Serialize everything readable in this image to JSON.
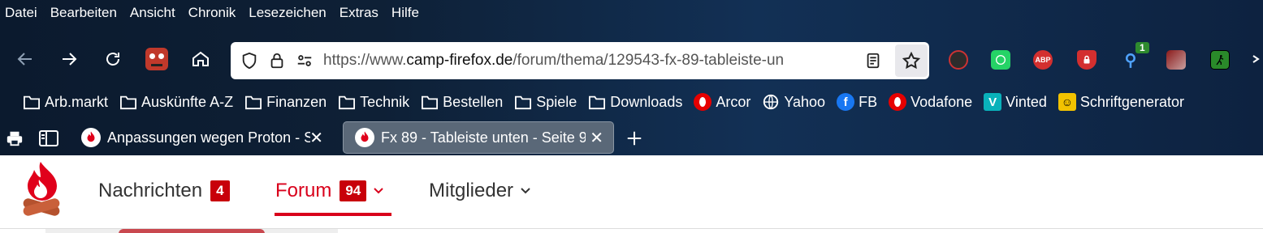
{
  "menubar": {
    "items": [
      "Datei",
      "Bearbeiten",
      "Ansicht",
      "Chronik",
      "Lesezeichen",
      "Extras",
      "Hilfe"
    ]
  },
  "toolbar": {
    "back_icon": "arrow-left-icon",
    "forward_icon": "arrow-right-icon",
    "reload_icon": "reload-icon",
    "home_icon": "home-icon"
  },
  "urlbar": {
    "url_prefix": "https://www.",
    "url_domain": "camp-firefox.de",
    "url_path": "/forum/thema/129543-fx-89-tableiste-un"
  },
  "extensions": {
    "badge_count": "1",
    "abp_label": "ABP"
  },
  "bookmarks": {
    "items": [
      {
        "label": "Arb.markt",
        "icon": "folder-icon"
      },
      {
        "label": "Auskünfte A-Z",
        "icon": "folder-icon"
      },
      {
        "label": "Finanzen",
        "icon": "folder-icon"
      },
      {
        "label": "Technik",
        "icon": "folder-icon"
      },
      {
        "label": "Bestellen",
        "icon": "folder-icon"
      },
      {
        "label": "Spiele",
        "icon": "folder-icon"
      },
      {
        "label": "Downloads",
        "icon": "folder-icon"
      },
      {
        "label": "Arcor",
        "icon": "vodafone-icon"
      },
      {
        "label": "Yahoo",
        "icon": "globe-icon"
      },
      {
        "label": "FB",
        "icon": "facebook-icon"
      },
      {
        "label": "Vodafone",
        "icon": "vodafone-icon"
      },
      {
        "label": "Vinted",
        "icon": "vinted-icon"
      },
      {
        "label": "Schriftgenerator",
        "icon": "smiley-icon"
      }
    ]
  },
  "tabs": [
    {
      "title": "Anpassungen wegen Proton - Sc",
      "active": false
    },
    {
      "title": "Fx 89 - Tableiste unten - Seite 9",
      "active": true
    }
  ],
  "site_nav": {
    "messages_label": "Nachrichten",
    "messages_count": "4",
    "forum_label": "Forum",
    "forum_count": "94",
    "members_label": "Mitglieder"
  },
  "colors": {
    "accent": "#d9001b",
    "badge": "#c8000a",
    "chrome_bg": "#0e2036"
  }
}
